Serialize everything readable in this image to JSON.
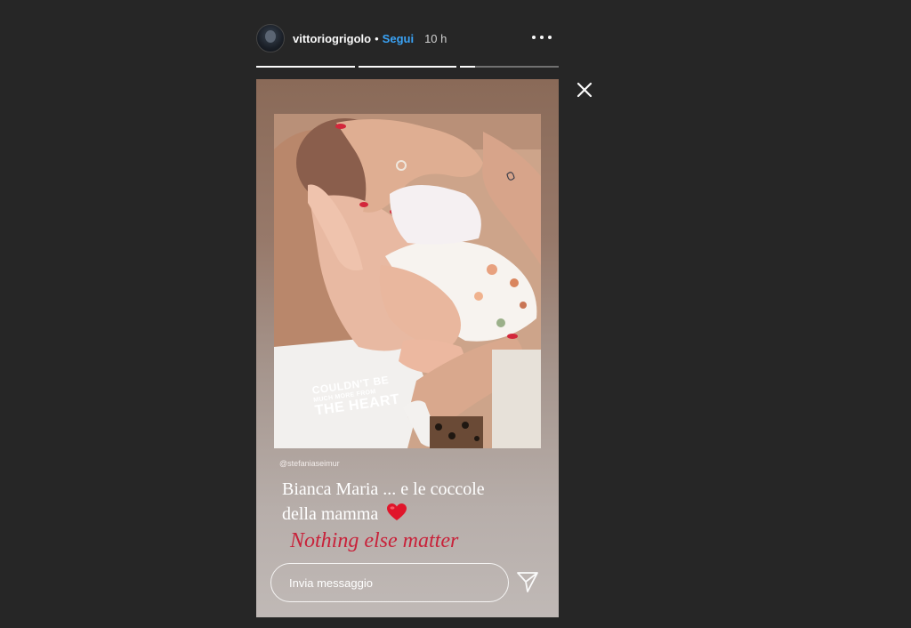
{
  "header": {
    "username": "vittoriogrigolo",
    "separator": "•",
    "follow_label": "Segui",
    "time": "10 h"
  },
  "progress": {
    "segments": 3,
    "current_segment": 3,
    "current_fraction": 0.15
  },
  "story": {
    "photo_text_line1": "COULDN'T BE",
    "photo_text_line2": "MUCH MORE FROM",
    "photo_text_line3": "THE HEART",
    "mention": "@stefaniaseimur",
    "caption_line1": "Bianca Maria ... e le coccole",
    "caption_line2": "della mamma",
    "caption_emoji": "red-heart-icon",
    "tagline": "Nothing else matter"
  },
  "reply": {
    "placeholder": "Invia messaggio"
  },
  "colors": {
    "background": "#262626",
    "follow": "#3aa3f6",
    "tagline": "#c8223a",
    "heart": "#e0162b"
  },
  "icons": {
    "more": "more-options-icon",
    "close": "close-icon",
    "send": "send-icon"
  }
}
